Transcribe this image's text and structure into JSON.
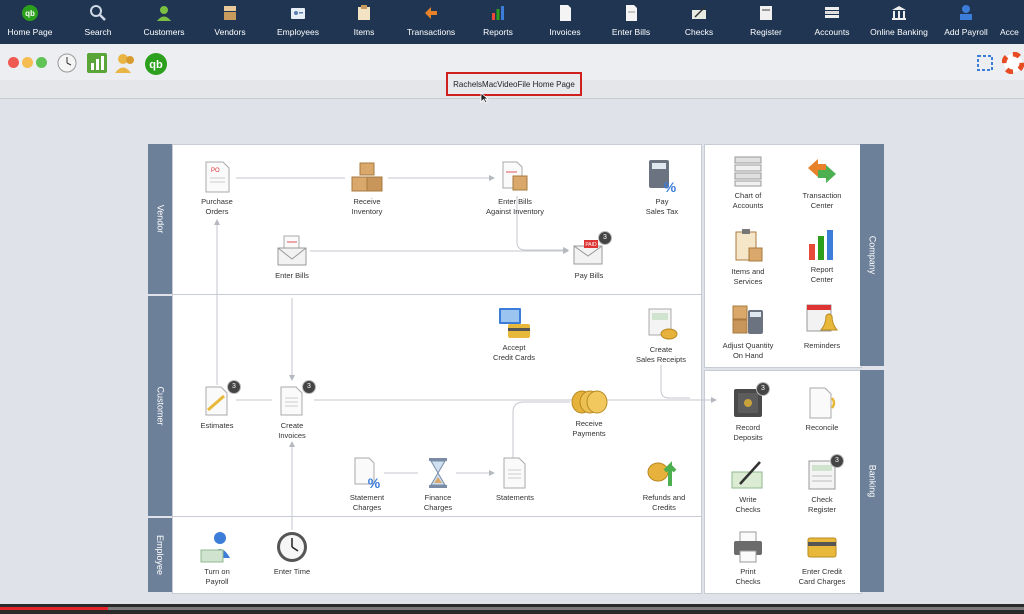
{
  "toolbar": {
    "items": [
      {
        "label": "Home Page",
        "icon": "qb-logo-icon"
      },
      {
        "label": "Search",
        "icon": "search-icon"
      },
      {
        "label": "Customers",
        "icon": "customers-icon"
      },
      {
        "label": "Vendors",
        "icon": "vendors-icon"
      },
      {
        "label": "Employees",
        "icon": "employees-icon"
      },
      {
        "label": "Items",
        "icon": "items-icon"
      },
      {
        "label": "Transactions",
        "icon": "transactions-icon"
      },
      {
        "label": "Reports",
        "icon": "reports-icon"
      },
      {
        "label": "Invoices",
        "icon": "invoices-icon"
      },
      {
        "label": "Enter Bills",
        "icon": "enter-bills-icon"
      },
      {
        "label": "Checks",
        "icon": "checks-icon"
      },
      {
        "label": "Register",
        "icon": "register-icon"
      },
      {
        "label": "Accounts",
        "icon": "accounts-icon"
      },
      {
        "label": "Online Banking",
        "icon": "bank-icon"
      },
      {
        "label": "Add Payroll",
        "icon": "add-payroll-icon"
      },
      {
        "label": "Acce",
        "icon": "accountant-icon"
      }
    ]
  },
  "window": {
    "title": "RachelsMacVideoFile Home Page"
  },
  "sections": {
    "vendor": "Vendor",
    "customer": "Customer",
    "employee": "Employee",
    "company": "Company",
    "banking": "Banking"
  },
  "vendor": {
    "purchase_orders": "Purchase\nOrders",
    "receive_inventory": "Receive\nInventory",
    "enter_bills_against_inventory": "Enter Bills\nAgainst Inventory",
    "pay_sales_tax": "Pay\nSales Tax",
    "enter_bills": "Enter Bills",
    "pay_bills": "Pay Bills",
    "pay_bills_badge": "3"
  },
  "customer": {
    "accept_credit_cards": "Accept\nCredit Cards",
    "create_sales_receipts": "Create\nSales Receipts",
    "estimates": "Estimates",
    "estimates_badge": "3",
    "create_invoices": "Create\nInvoices",
    "create_invoices_badge": "3",
    "receive_payments": "Receive\nPayments",
    "statement_charges": "Statement\nCharges",
    "finance_charges": "Finance\nCharges",
    "statements": "Statements",
    "refunds_and_credits": "Refunds and\nCredits"
  },
  "employee": {
    "turn_on_payroll": "Turn on\nPayroll",
    "enter_time": "Enter Time"
  },
  "company": {
    "chart_of_accounts": "Chart of\nAccounts",
    "transaction_center": "Transaction\nCenter",
    "items_and_services": "Items and\nServices",
    "report_center": "Report\nCenter",
    "adjust_quantity": "Adjust Quantity\nOn Hand",
    "reminders": "Reminders"
  },
  "banking": {
    "record_deposits": "Record\nDeposits",
    "record_deposits_badge": "3",
    "reconcile": "Reconcile",
    "write_checks": "Write\nChecks",
    "check_register": "Check\nRegister",
    "check_register_badge": "3",
    "print_checks": "Print\nChecks",
    "enter_credit_card_charges": "Enter Credit\nCard Charges"
  }
}
